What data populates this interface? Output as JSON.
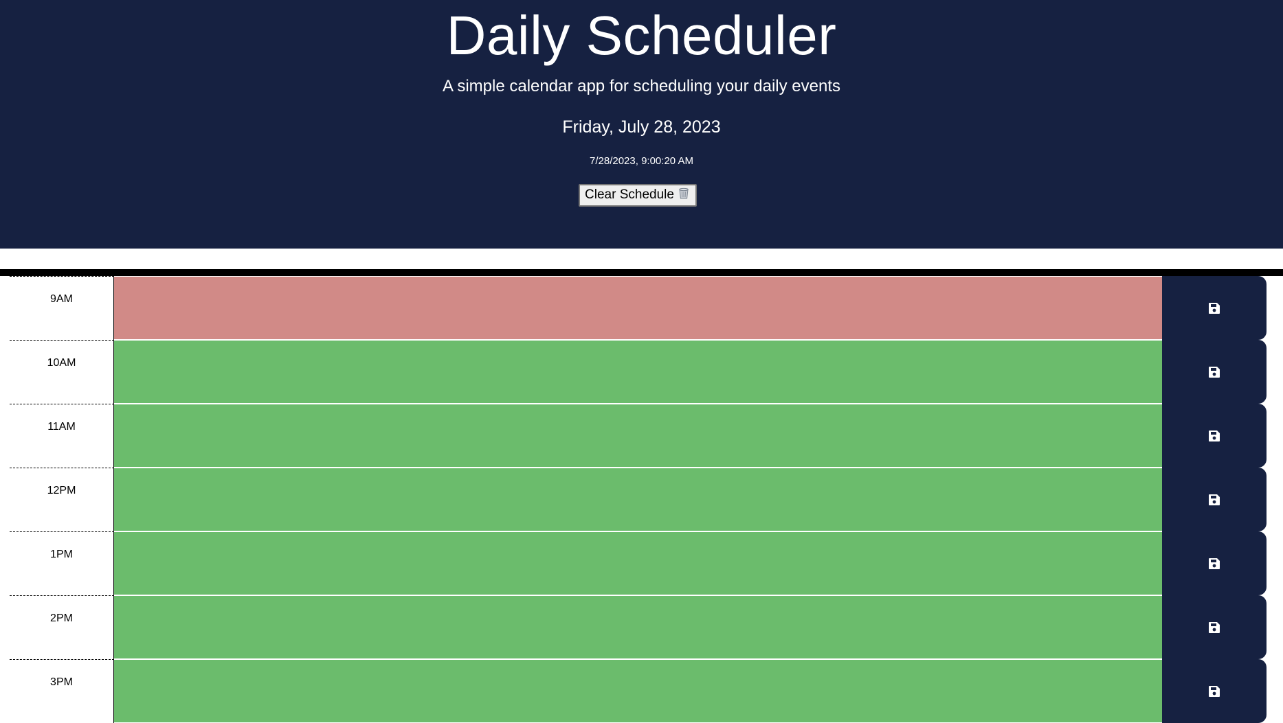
{
  "header": {
    "title": "Daily Scheduler",
    "subtitle": "A simple calendar app for scheduling your daily events",
    "current_day": "Friday, July 28, 2023",
    "current_time": "7/28/2023, 9:00:20 AM",
    "clear_button_label": "Clear Schedule",
    "clear_button_icon": "wastebasket-icon"
  },
  "schedule": {
    "rows": [
      {
        "hour": "9AM",
        "status": "present",
        "text": ""
      },
      {
        "hour": "10AM",
        "status": "future",
        "text": ""
      },
      {
        "hour": "11AM",
        "status": "future",
        "text": ""
      },
      {
        "hour": "12PM",
        "status": "future",
        "text": ""
      },
      {
        "hour": "1PM",
        "status": "future",
        "text": ""
      },
      {
        "hour": "2PM",
        "status": "future",
        "text": ""
      },
      {
        "hour": "3PM",
        "status": "future",
        "text": ""
      }
    ],
    "save_icon": "floppy-disk-icon"
  },
  "colors": {
    "header_background": "#162141",
    "present": "#d18a87",
    "future": "#6bbc6c",
    "past": "#d3d3d3",
    "save_button": "#162141"
  }
}
